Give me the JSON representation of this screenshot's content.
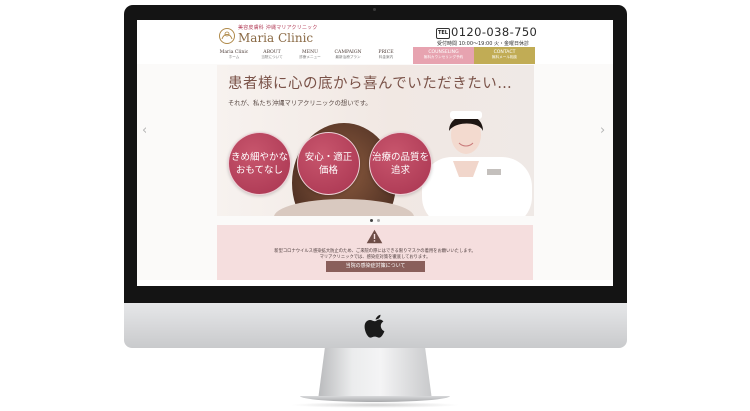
{
  "site": {
    "logo_sub": "美容皮膚科 沖縄マリアクリニック",
    "logo_name": "Maria Clinic",
    "tel_badge": "TEL",
    "phone": "0120-038-750",
    "hours": "受付時間 10:00〜19:00 火・金曜日休診"
  },
  "nav": {
    "items": [
      {
        "en": "Maria Clinic",
        "jp": "ホーム"
      },
      {
        "en": "ABOUT",
        "jp": "当院について"
      },
      {
        "en": "MENU",
        "jp": "診療メニュー"
      },
      {
        "en": "CAMPAIGN",
        "jp": "最新治療プラン"
      },
      {
        "en": "PRICE",
        "jp": "料金案内"
      }
    ],
    "counseling": {
      "en": "COUNSELING",
      "jp": "無料カウンセリング予約"
    },
    "contact": {
      "en": "CONTACT",
      "jp": "無料メール相談"
    }
  },
  "hero": {
    "title": "患者様に心の底から喜んでいただきたい…",
    "subtitle": "それが、私たち沖縄マリアクリニックの想いです。",
    "bubbles": [
      "きめ細やかな\nおもてなし",
      "安心・適正\n価格",
      "治療の品質を\n追求"
    ]
  },
  "slider": {
    "prev_arrow": "‹",
    "next_arrow": "›",
    "slide_count": 2,
    "active_slide": 1
  },
  "notice": {
    "line1": "新型コロナウイルス感染拡大防止のため、ご来院の際にはできる限りマスクの着用をお願いいたします。",
    "line2": "マリアクリニックでは、感染症対策を徹底しております。",
    "button": "当院の感染症対策について"
  },
  "colors": {
    "accent": "#b23b56",
    "bubble": "#b23d57",
    "counseling": "#e7a3b0",
    "contact": "#c1ac55",
    "notice_bg": "#f5dede",
    "notice_button": "#8a5f5b"
  },
  "icons": [
    "apple-logo",
    "logo-mark-icon",
    "warning-icon",
    "chevron-left-icon",
    "chevron-right-icon"
  ]
}
